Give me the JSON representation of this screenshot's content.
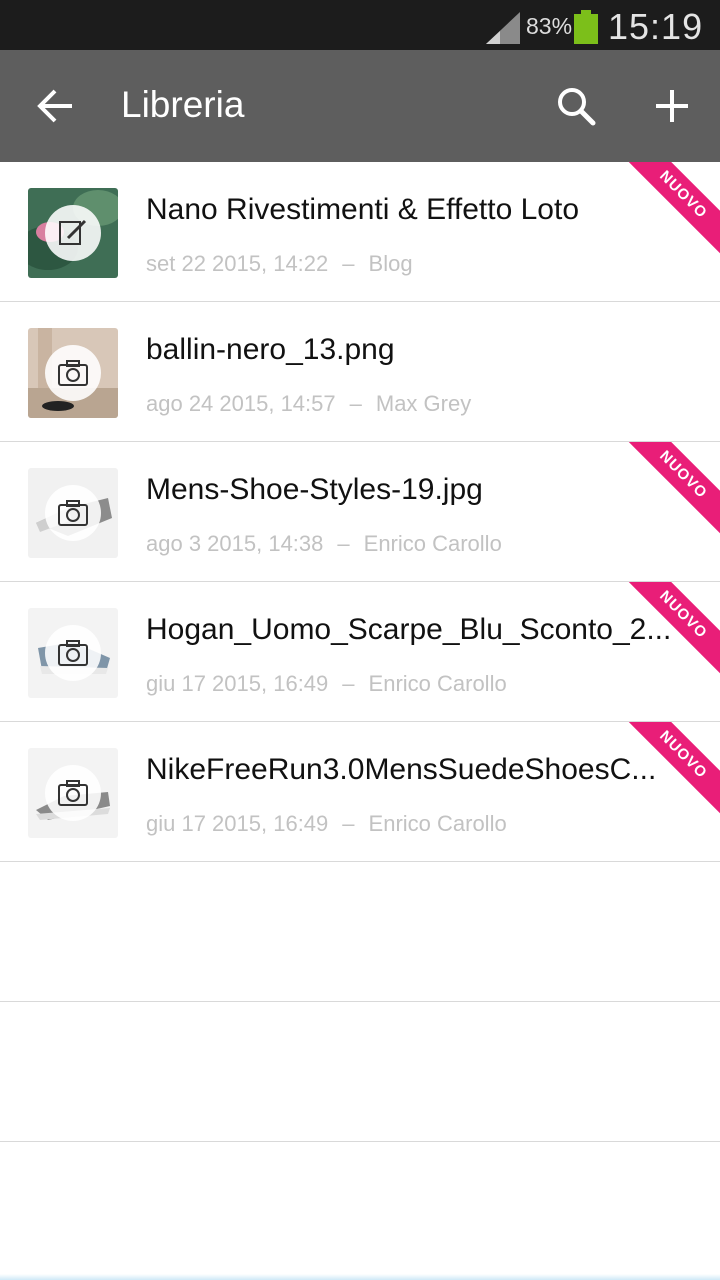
{
  "status_bar": {
    "battery_percent": "83%",
    "time": "15:19",
    "battery_color": "#7cbf1a"
  },
  "app_bar": {
    "title": "Libreria",
    "back_icon": "arrow-left-icon",
    "search_icon": "search-icon",
    "add_icon": "plus-icon"
  },
  "new_ribbon_color": "#e91e78",
  "items": [
    {
      "title": "Nano Rivestimenti & Effetto Loto",
      "date": "set 22 2015, 14:22",
      "author": "Blog",
      "icon": "edit-icon",
      "new_label": "NUOVO"
    },
    {
      "title": "ballin-nero_13.png",
      "date": "ago 24 2015, 14:57",
      "author": "Max Grey",
      "icon": "camera-icon",
      "new_label": ""
    },
    {
      "title": "Mens-Shoe-Styles-19.jpg",
      "date": "ago 3 2015, 14:38",
      "author": "Enrico  Carollo",
      "icon": "camera-icon",
      "new_label": "NUOVO"
    },
    {
      "title": "Hogan_Uomo_Scarpe_Blu_Sconto_2...",
      "date": "giu 17 2015, 16:49",
      "author": "Enrico  Carollo",
      "icon": "camera-icon",
      "new_label": "NUOVO"
    },
    {
      "title": "NikeFreeRun3.0MensSuedeShoesC...",
      "date": "giu 17 2015, 16:49",
      "author": "Enrico  Carollo",
      "icon": "camera-icon",
      "new_label": "NUOVO"
    }
  ],
  "meta_separator": "–"
}
